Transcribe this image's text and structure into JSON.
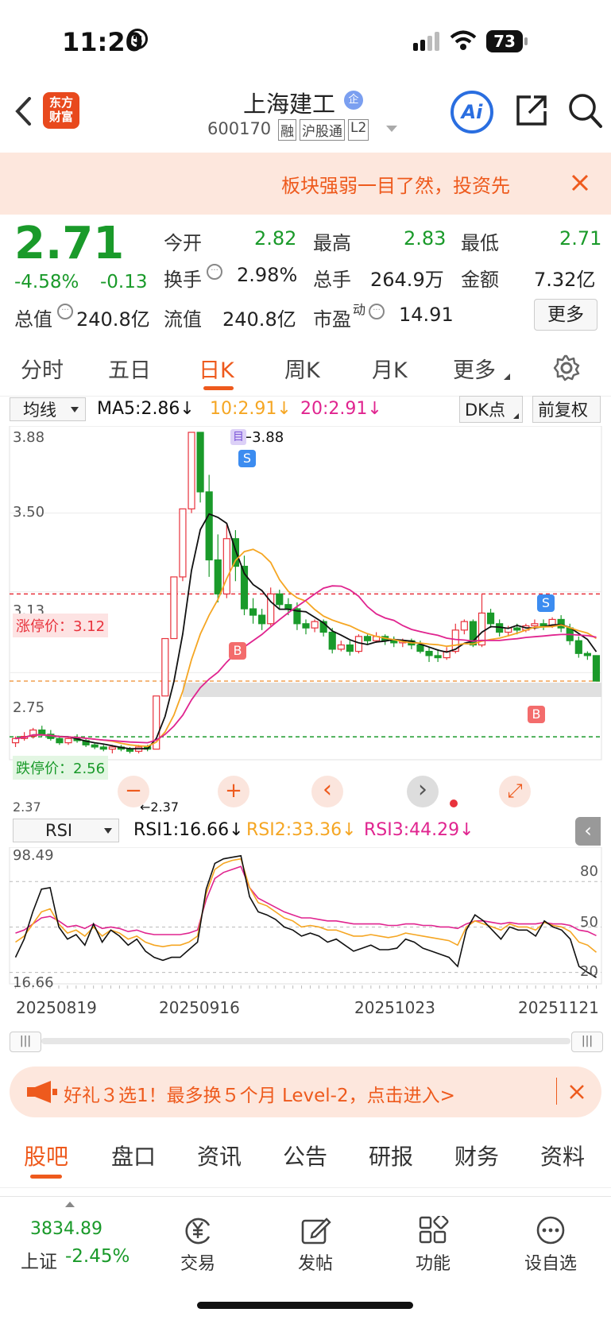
{
  "status_bar": {
    "time": "11:20",
    "battery": "73"
  },
  "header": {
    "logo_line1": "东方",
    "logo_line2": "财富",
    "title": "上海建工",
    "badge": "企",
    "code": "600170",
    "tags": [
      "融",
      "沪股通",
      "L2"
    ]
  },
  "banner": {
    "text": "板块强弱一目了然，投资先"
  },
  "quote": {
    "price": "2.71",
    "change_pct": "-4.58%",
    "change": "-0.13",
    "open_label": "今开",
    "open": "2.82",
    "high_label": "最高",
    "high": "2.83",
    "low_label": "最低",
    "low": "2.71",
    "turnover_label": "换手",
    "turnover": "2.98%",
    "volume_label": "总手",
    "volume": "264.9万",
    "amount_label": "金额",
    "amount": "7.32亿",
    "mktcap_label": "总值",
    "mktcap": "240.8亿",
    "float_label": "流值",
    "float": "240.8亿",
    "pe_label": "市盈",
    "pe_sup": "动",
    "pe": "14.91",
    "more": "更多"
  },
  "tabs": [
    "分时",
    "五日",
    "日K",
    "周K",
    "月K",
    "更多"
  ],
  "toolbar": {
    "ma_select": "均线",
    "ma5": "MA5:2.86↓",
    "ma10": "10:2.91↓",
    "ma20": "20:2.91↓",
    "dk": "DK点",
    "fq": "前复权"
  },
  "colors": {
    "up": "#e8323c",
    "down": "#1a9a2a",
    "ma5": "#111111",
    "ma10": "#f5a623",
    "ma20": "#e0248f",
    "accent": "#ee5a1d"
  },
  "chart_labels": {
    "y_ticks": [
      "3.88",
      "3.50",
      "3.13",
      "2.75",
      "2.37"
    ],
    "limit_up": "涨停价：3.12",
    "limit_down": "跌停价：2.56",
    "high_marker": "3.88",
    "low_marker": "2.37",
    "buy_marker": "B",
    "sell_marker": "S",
    "day_marker": "目"
  },
  "chart_data": {
    "type": "candlestick",
    "ylim": [
      2.37,
      3.88
    ],
    "candles": [
      [
        2.42,
        2.44,
        2.4,
        2.45
      ],
      [
        2.44,
        2.45,
        2.43,
        2.47
      ],
      [
        2.45,
        2.48,
        2.44,
        2.49
      ],
      [
        2.48,
        2.46,
        2.45,
        2.5
      ],
      [
        2.46,
        2.44,
        2.43,
        2.48
      ],
      [
        2.44,
        2.42,
        2.41,
        2.45
      ],
      [
        2.42,
        2.44,
        2.41,
        2.45
      ],
      [
        2.44,
        2.43,
        2.42,
        2.46
      ],
      [
        2.43,
        2.41,
        2.4,
        2.44
      ],
      [
        2.41,
        2.4,
        2.39,
        2.42
      ],
      [
        2.4,
        2.39,
        2.38,
        2.41
      ],
      [
        2.39,
        2.4,
        2.37,
        2.41
      ],
      [
        2.4,
        2.39,
        2.38,
        2.41
      ],
      [
        2.39,
        2.38,
        2.37,
        2.4
      ],
      [
        2.38,
        2.4,
        2.37,
        2.41
      ],
      [
        2.4,
        2.39,
        2.38,
        2.41
      ],
      [
        2.39,
        2.64,
        2.39,
        2.64
      ],
      [
        2.64,
        2.91,
        2.64,
        2.91
      ],
      [
        2.91,
        3.2,
        2.91,
        3.2
      ],
      [
        3.2,
        3.52,
        3.18,
        3.52
      ],
      [
        3.52,
        3.88,
        3.5,
        3.88
      ],
      [
        3.88,
        3.6,
        3.55,
        3.88
      ],
      [
        3.6,
        3.28,
        3.2,
        3.68
      ],
      [
        3.28,
        3.12,
        3.08,
        3.4
      ],
      [
        3.12,
        3.38,
        3.1,
        3.45
      ],
      [
        3.38,
        3.25,
        3.18,
        3.42
      ],
      [
        3.25,
        3.05,
        3.02,
        3.3
      ],
      [
        3.05,
        3.02,
        2.98,
        3.1
      ],
      [
        3.02,
        2.98,
        2.95,
        3.05
      ],
      [
        2.98,
        3.12,
        2.97,
        3.15
      ],
      [
        3.12,
        3.07,
        3.05,
        3.14
      ],
      [
        3.07,
        3.05,
        3.02,
        3.1
      ],
      [
        3.05,
        2.98,
        2.95,
        3.08
      ],
      [
        2.98,
        2.96,
        2.93,
        3.0
      ],
      [
        2.96,
        2.99,
        2.94,
        3.0
      ],
      [
        2.99,
        2.94,
        2.92,
        3.0
      ],
      [
        2.94,
        2.86,
        2.84,
        2.96
      ],
      [
        2.86,
        2.88,
        2.85,
        2.9
      ],
      [
        2.88,
        2.85,
        2.83,
        2.9
      ],
      [
        2.85,
        2.92,
        2.84,
        2.93
      ],
      [
        2.92,
        2.9,
        2.88,
        2.93
      ],
      [
        2.9,
        2.92,
        2.89,
        2.94
      ],
      [
        2.92,
        2.9,
        2.88,
        2.93
      ],
      [
        2.9,
        2.89,
        2.87,
        2.92
      ],
      [
        2.89,
        2.9,
        2.87,
        2.91
      ],
      [
        2.9,
        2.88,
        2.86,
        2.91
      ],
      [
        2.88,
        2.85,
        2.84,
        2.9
      ],
      [
        2.85,
        2.83,
        2.8,
        2.87
      ],
      [
        2.83,
        2.82,
        2.8,
        2.86
      ],
      [
        2.82,
        2.85,
        2.81,
        2.87
      ],
      [
        2.85,
        2.95,
        2.84,
        2.98
      ],
      [
        2.95,
        2.99,
        2.93,
        3.0
      ],
      [
        2.99,
        2.88,
        2.87,
        3.0
      ],
      [
        2.88,
        3.03,
        2.87,
        3.12
      ],
      [
        3.03,
        2.98,
        2.96,
        3.05
      ],
      [
        2.98,
        2.94,
        2.92,
        3.0
      ],
      [
        2.94,
        2.96,
        2.92,
        2.97
      ],
      [
        2.96,
        2.95,
        2.93,
        2.98
      ],
      [
        2.95,
        2.97,
        2.94,
        2.98
      ],
      [
        2.97,
        2.98,
        2.95,
        3.0
      ],
      [
        2.98,
        2.97,
        2.95,
        3.0
      ],
      [
        2.97,
        3.0,
        2.96,
        3.01
      ],
      [
        3.0,
        2.96,
        2.94,
        3.02
      ],
      [
        2.96,
        2.9,
        2.88,
        2.98
      ],
      [
        2.9,
        2.84,
        2.82,
        2.92
      ],
      [
        2.84,
        2.83,
        2.81,
        2.85
      ],
      [
        2.83,
        2.71,
        2.71,
        2.83
      ]
    ],
    "ma5_last": 2.86,
    "ma10_last": 2.91,
    "ma20_last": 2.91
  },
  "chart_controls": {
    "zoom_out": "−",
    "zoom_in": "+",
    "prev": "‹",
    "next": "›",
    "expand": "⤢"
  },
  "rsi": {
    "select": "RSI",
    "rsi1": "RSI1:16.66↓",
    "rsi2": "RSI2:33.36↓",
    "rsi3": "RSI3:44.29↓",
    "y_top": "98.49",
    "y_bottom": "16.66",
    "levels": [
      "80",
      "50",
      "20"
    ],
    "rsi1_values": [
      30,
      42,
      60,
      75,
      76,
      50,
      42,
      45,
      38,
      52,
      40,
      48,
      44,
      38,
      42,
      34,
      30,
      28,
      30,
      30,
      35,
      40,
      75,
      92,
      95,
      96,
      97,
      70,
      60,
      58,
      55,
      50,
      48,
      44,
      46,
      44,
      40,
      42,
      38,
      34,
      36,
      38,
      35,
      35,
      36,
      42,
      40,
      36,
      34,
      32,
      30,
      24,
      48,
      58,
      54,
      48,
      42,
      50,
      48,
      48,
      44,
      54,
      50,
      48,
      42,
      24,
      20,
      16.66
    ],
    "rsi2_values": [
      40,
      44,
      52,
      60,
      62,
      52,
      46,
      48,
      44,
      50,
      44,
      48,
      46,
      42,
      44,
      40,
      38,
      37,
      38,
      38,
      40,
      44,
      72,
      88,
      92,
      94,
      95,
      76,
      66,
      64,
      60,
      56,
      54,
      50,
      51,
      50,
      48,
      48,
      46,
      44,
      44,
      45,
      44,
      43,
      44,
      46,
      45,
      44,
      43,
      42,
      41,
      38,
      50,
      54,
      52,
      50,
      48,
      52,
      50,
      50,
      48,
      53,
      51,
      50,
      47,
      40,
      38,
      33.36
    ],
    "rsi3_values": [
      46,
      48,
      52,
      56,
      57,
      54,
      50,
      51,
      49,
      52,
      49,
      50,
      49,
      47,
      48,
      46,
      45,
      45,
      45,
      45,
      46,
      48,
      68,
      82,
      86,
      88,
      90,
      76,
      69,
      66,
      63,
      60,
      58,
      56,
      56,
      55,
      54,
      54,
      53,
      52,
      52,
      52,
      52,
      51,
      51,
      52,
      52,
      51,
      51,
      50,
      50,
      49,
      52,
      54,
      54,
      53,
      52,
      53,
      52,
      52,
      52,
      53,
      52,
      52,
      51,
      48,
      47,
      44.29
    ]
  },
  "dates": [
    "20250819",
    "20250916",
    "20251023",
    "20251121"
  ],
  "promo": {
    "text": "好礼３选1！最多换５个月 Level-2，点击进入>"
  },
  "bottom_tabs": [
    "股吧",
    "盘口",
    "资讯",
    "公告",
    "研报",
    "财务",
    "资料"
  ],
  "dock": {
    "index_value": "3834.89",
    "index_name": "上证",
    "index_change": "-2.45%",
    "trade": "交易",
    "post": "发帖",
    "func": "功能",
    "watch": "设自选"
  }
}
